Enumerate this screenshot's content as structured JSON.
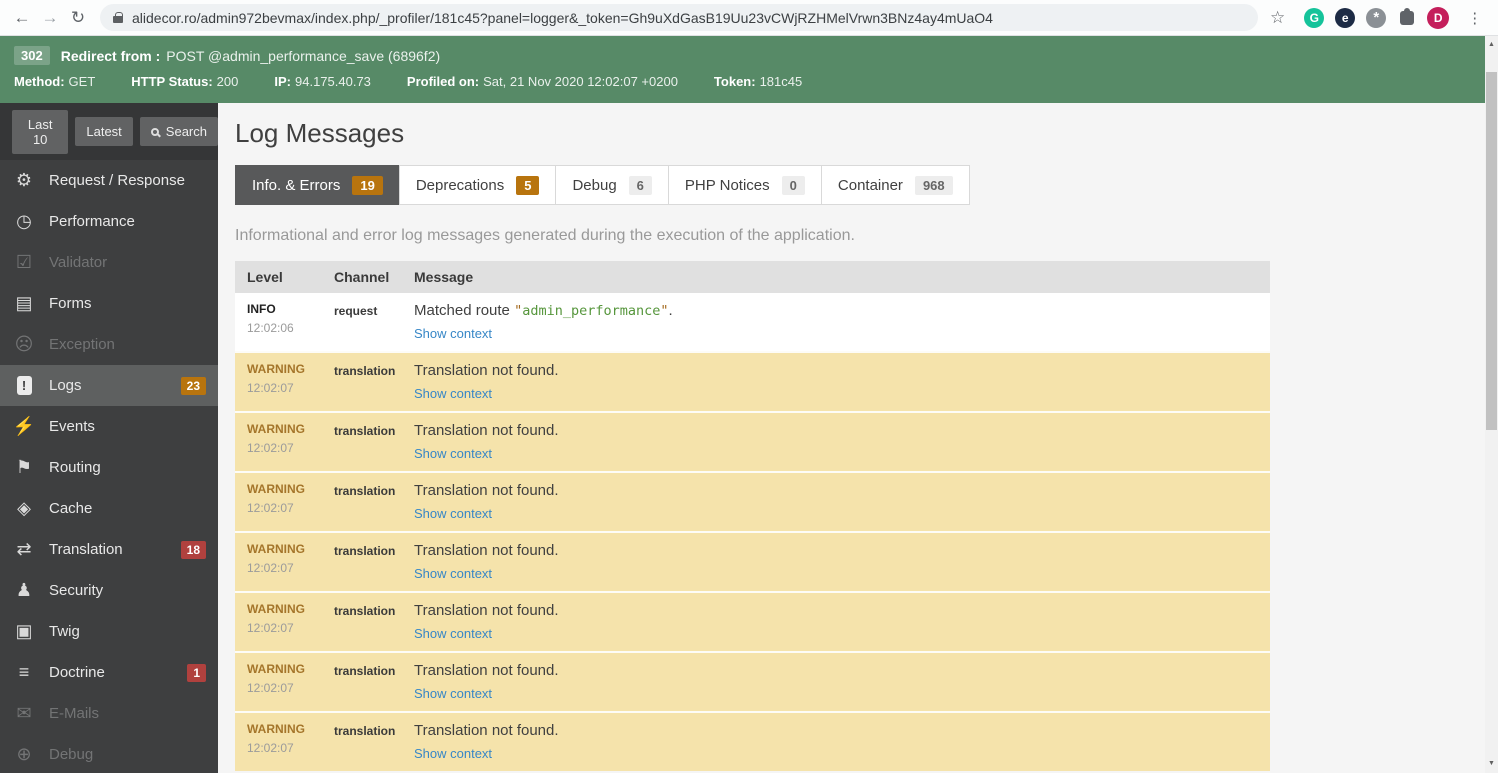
{
  "icons": {
    "back": "←",
    "forward": "→",
    "reload": "↻",
    "star": "☆",
    "kebab": "⋮",
    "grammarly_letter": "G",
    "e_letter": "e",
    "pinwheel_mark": "*",
    "avatar_letter": "D",
    "gears": "⚙",
    "stopwatch": "◷",
    "checkbox": "☑",
    "clipboard": "▤",
    "ghost": "☹",
    "logs_mark": "!",
    "broadcast": "⚡",
    "signpost": "⚑",
    "layers": "◈",
    "translate": "⇄",
    "person": "♟",
    "window": "▣",
    "database": "≡",
    "envelope": "✉",
    "target": "⊕",
    "up_arrow": "▲",
    "down_arrow": "▼"
  },
  "browser": {
    "url": "alidecor.ro/admin972bevmax/index.php/_profiler/181c45?panel=logger&_token=Gh9uXdGasB19Uu23vCWjRZHMelVrwn3BNz4ay4mUaO4"
  },
  "banner": {
    "status_code": "302",
    "redirect_label": "Redirect from :",
    "redirect_value": "POST @admin_performance_save (6896f2)",
    "fields": [
      {
        "label": "Method:",
        "value": "GET"
      },
      {
        "label": "HTTP Status:",
        "value": "200"
      },
      {
        "label": "IP:",
        "value": "94.175.40.73"
      },
      {
        "label": "Profiled on:",
        "value": "Sat, 21 Nov 2020 12:02:07 +0200"
      },
      {
        "label": "Token:",
        "value": "181c45"
      }
    ],
    "color": "#578a67"
  },
  "sidebar": {
    "buttons": [
      {
        "label": "Last 10"
      },
      {
        "label": "Latest"
      },
      {
        "label": "Search",
        "icon": "search-icon"
      }
    ],
    "items": [
      {
        "label": "Request / Response",
        "icon": "gears-icon",
        "state": "normal"
      },
      {
        "label": "Performance",
        "icon": "stopwatch-icon",
        "state": "normal"
      },
      {
        "label": "Validator",
        "icon": "checkbox-icon",
        "state": "disabled"
      },
      {
        "label": "Forms",
        "icon": "clipboard-icon",
        "state": "normal"
      },
      {
        "label": "Exception",
        "icon": "ghost-icon",
        "state": "disabled"
      },
      {
        "label": "Logs",
        "icon": "log-book-icon",
        "state": "active",
        "badge": "23",
        "badge_color": "#b8740e"
      },
      {
        "label": "Events",
        "icon": "broadcast-icon",
        "state": "normal"
      },
      {
        "label": "Routing",
        "icon": "signpost-icon",
        "state": "normal"
      },
      {
        "label": "Cache",
        "icon": "layers-icon",
        "state": "normal"
      },
      {
        "label": "Translation",
        "icon": "translate-icon",
        "state": "normal",
        "badge": "18",
        "badge_color": "#b0413e"
      },
      {
        "label": "Security",
        "icon": "person-icon",
        "state": "normal"
      },
      {
        "label": "Twig",
        "icon": "window-icon",
        "state": "normal"
      },
      {
        "label": "Doctrine",
        "icon": "database-icon",
        "state": "normal",
        "badge": "1",
        "badge_color": "#b0413e"
      },
      {
        "label": "E-Mails",
        "icon": "envelope-icon",
        "state": "disabled"
      },
      {
        "label": "Debug",
        "icon": "target-icon",
        "state": "disabled"
      }
    ]
  },
  "main": {
    "title": "Log Messages",
    "tabs": [
      {
        "label": "Info. & Errors",
        "count": "19",
        "active": true,
        "badge_style": "orange"
      },
      {
        "label": "Deprecations",
        "count": "5",
        "active": false,
        "badge_style": "orange"
      },
      {
        "label": "Debug",
        "count": "6",
        "active": false,
        "badge_style": "grey"
      },
      {
        "label": "PHP Notices",
        "count": "0",
        "active": false,
        "badge_style": "grey"
      },
      {
        "label": "Container",
        "count": "968",
        "active": false,
        "badge_style": "grey"
      }
    ],
    "description": "Informational and error log messages generated during the execution of the application.",
    "table": {
      "headers": {
        "level": "Level",
        "channel": "Channel",
        "message": "Message"
      },
      "rows": [
        {
          "type": "info",
          "level": "INFO",
          "time": "12:02:06",
          "channel": "request",
          "message": {
            "prefix": "Matched route ",
            "quote": "\"",
            "code": "admin_performance",
            "suffix": "."
          },
          "link": "Show context"
        },
        {
          "type": "warning",
          "level": "WARNING",
          "time": "12:02:07",
          "channel": "translation",
          "message": {
            "text": "Translation not found."
          },
          "link": "Show context"
        },
        {
          "type": "warning",
          "level": "WARNING",
          "time": "12:02:07",
          "channel": "translation",
          "message": {
            "text": "Translation not found."
          },
          "link": "Show context"
        },
        {
          "type": "warning",
          "level": "WARNING",
          "time": "12:02:07",
          "channel": "translation",
          "message": {
            "text": "Translation not found."
          },
          "link": "Show context"
        },
        {
          "type": "warning",
          "level": "WARNING",
          "time": "12:02:07",
          "channel": "translation",
          "message": {
            "text": "Translation not found."
          },
          "link": "Show context"
        },
        {
          "type": "warning",
          "level": "WARNING",
          "time": "12:02:07",
          "channel": "translation",
          "message": {
            "text": "Translation not found."
          },
          "link": "Show context"
        },
        {
          "type": "warning",
          "level": "WARNING",
          "time": "12:02:07",
          "channel": "translation",
          "message": {
            "text": "Translation not found."
          },
          "link": "Show context"
        },
        {
          "type": "warning",
          "level": "WARNING",
          "time": "12:02:07",
          "channel": "translation",
          "message": {
            "text": "Translation not found."
          },
          "link": "Show context"
        }
      ]
    }
  }
}
